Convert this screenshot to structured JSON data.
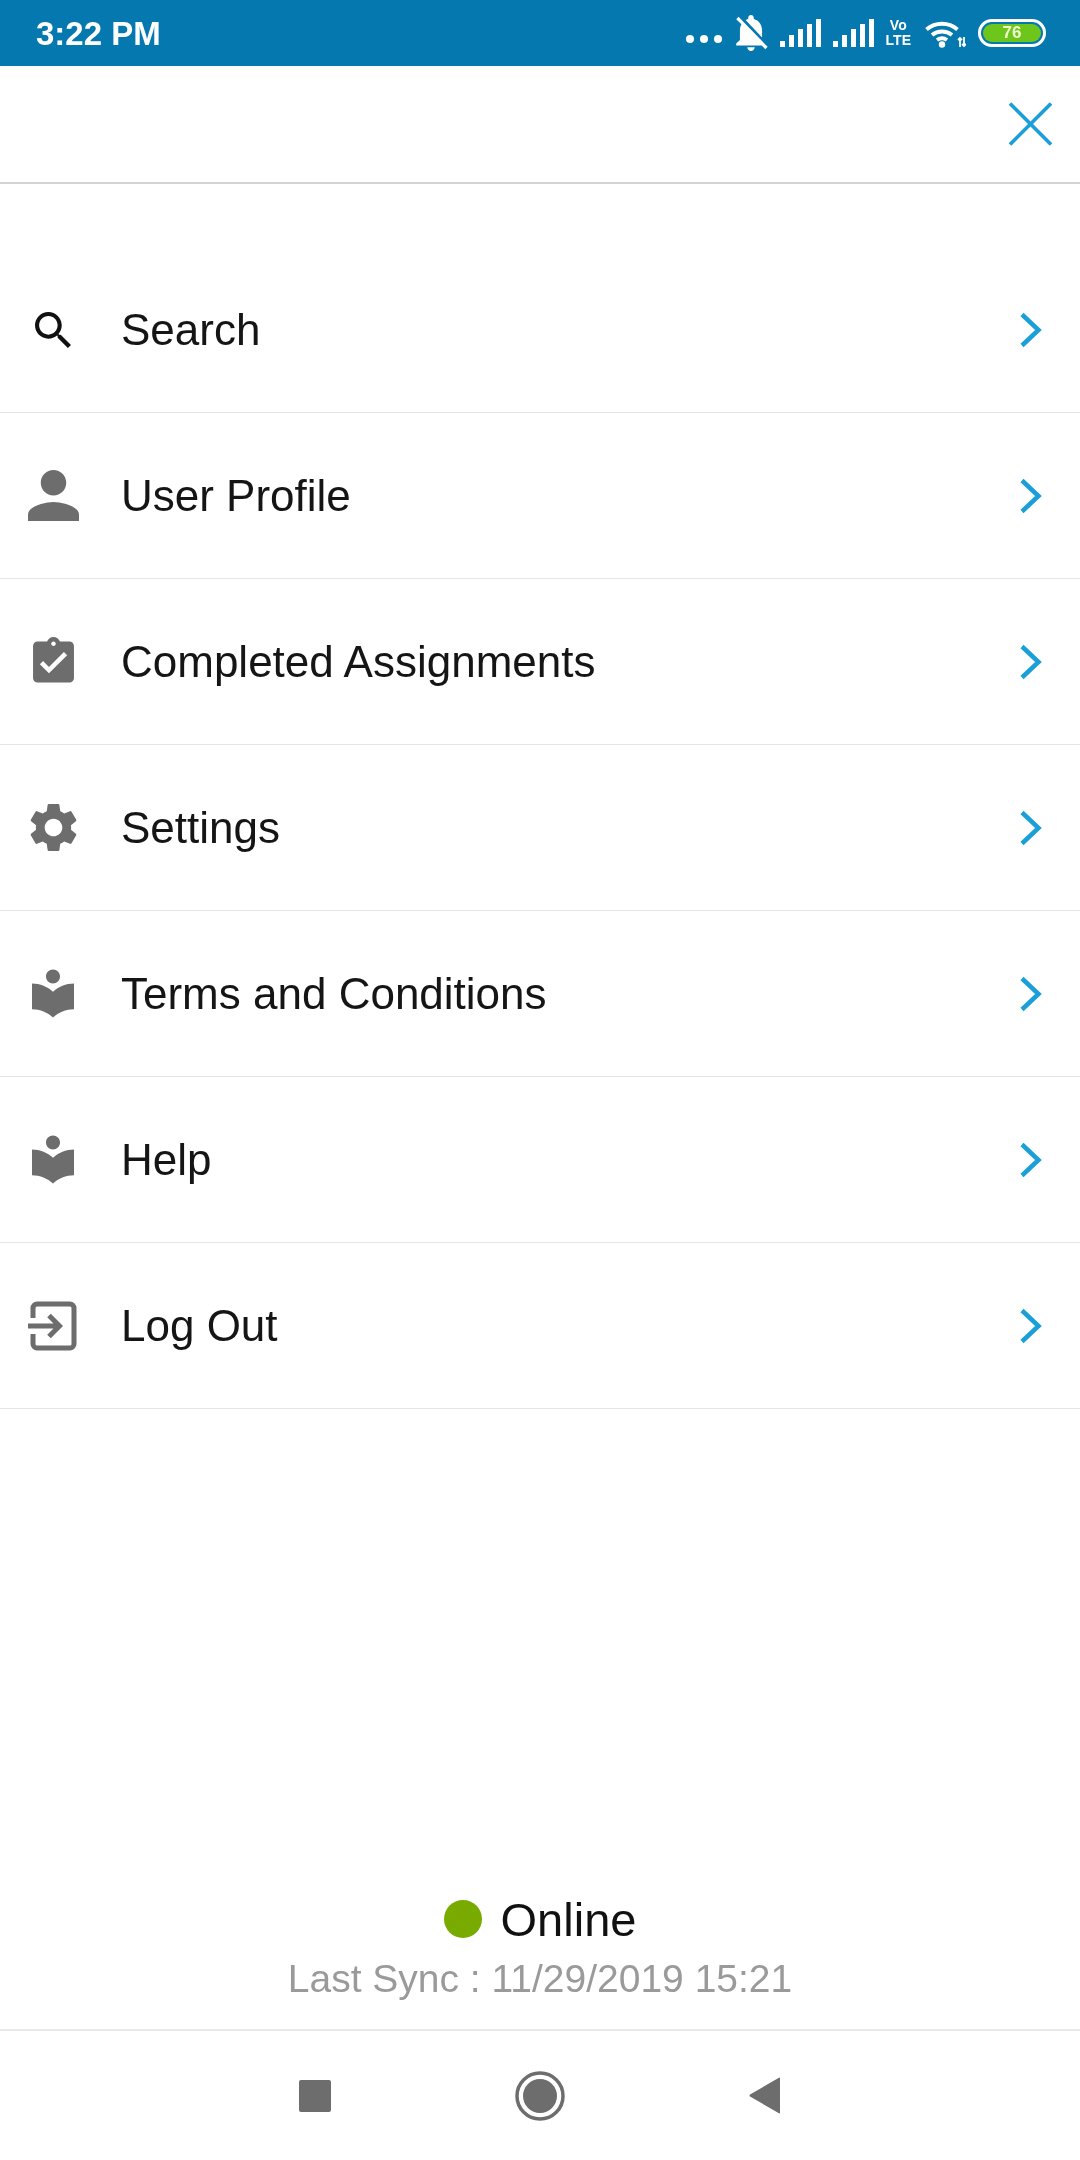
{
  "status_bar": {
    "time": "3:22 PM",
    "network": "Vo LTE",
    "battery": "76"
  },
  "menu": [
    {
      "label": "Search"
    },
    {
      "label": "User Profile"
    },
    {
      "label": "Completed Assignments"
    },
    {
      "label": "Settings"
    },
    {
      "label": "Terms and Conditions"
    },
    {
      "label": "Help"
    },
    {
      "label": "Log Out"
    }
  ],
  "connection": {
    "label": "Online",
    "online": true,
    "last_sync": "Last Sync : 11/29/2019 15:21"
  }
}
